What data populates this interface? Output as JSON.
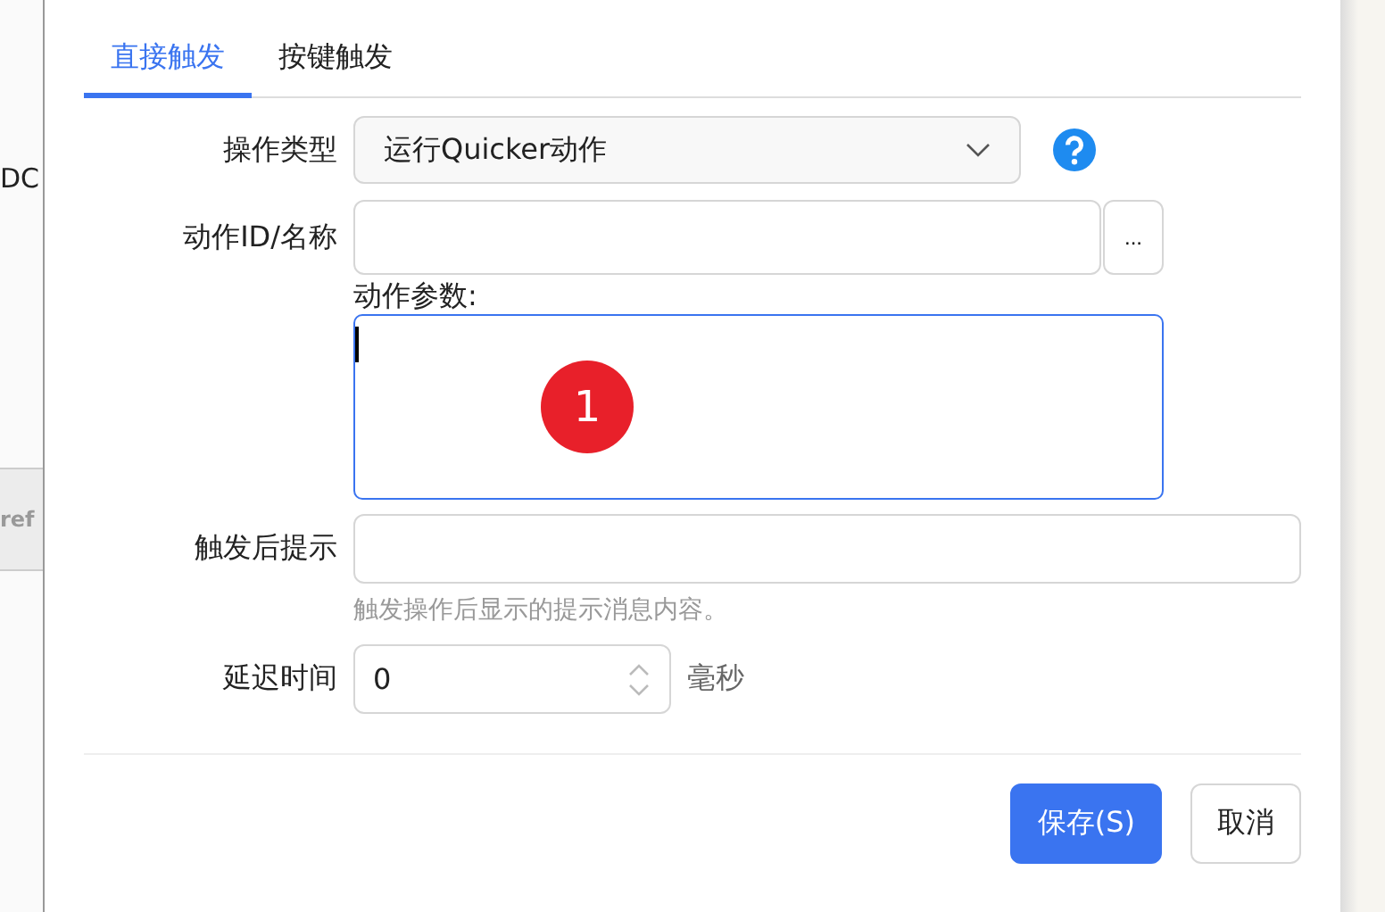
{
  "background": {
    "left_texts": [
      "DC"
    ],
    "left_chip": "ref"
  },
  "tabs": [
    {
      "label": "直接触发",
      "selected": true
    },
    {
      "label": "按键触发",
      "selected": false
    }
  ],
  "form": {
    "action_type": {
      "label": "操作类型",
      "value": "运行Quicker动作"
    },
    "action_id": {
      "label": "动作ID/名称",
      "browse_button": "..."
    },
    "action_params": {
      "label": "动作参数:",
      "focused": true
    },
    "badge": "1",
    "after_tip": {
      "label": "触发后提示",
      "hint": "触发操作后显示的提示消息内容。"
    },
    "delay": {
      "label": "延迟时间",
      "value": "0",
      "unit": "毫秒"
    }
  },
  "buttons": [
    {
      "label": "保存(S)",
      "kind": "primary"
    },
    {
      "label": "取消",
      "kind": "default"
    }
  ]
}
